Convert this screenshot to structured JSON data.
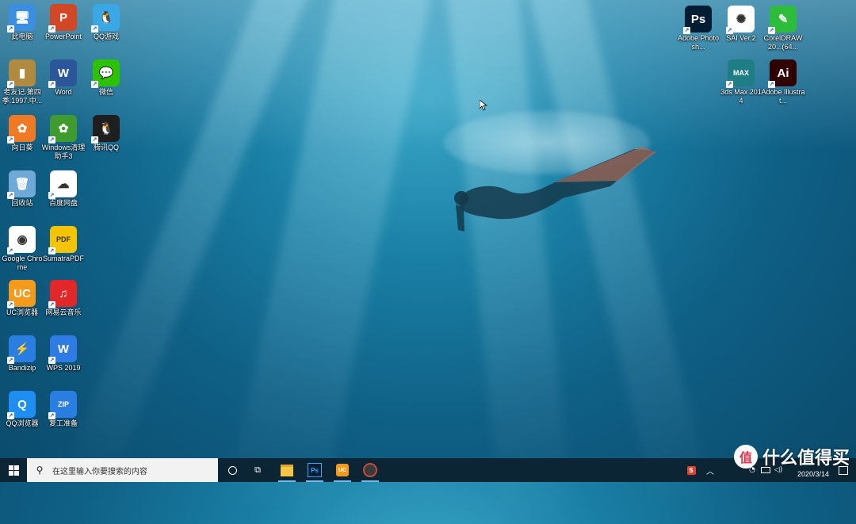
{
  "desktop": {
    "icons": [
      {
        "id": "computer",
        "label": "此电脑",
        "color": "#3b8ee0",
        "glyph": "🖥"
      },
      {
        "id": "powerpoint",
        "label": "PowerPoint",
        "color": "#d24726",
        "glyph": "P"
      },
      {
        "id": "qqgame",
        "label": "QQ游戏",
        "color": "#3aa7e6",
        "glyph": "🐧"
      },
      {
        "id": "laoyouji",
        "label": "老友记.第四季.1997.中...",
        "color": "#b08a3e",
        "glyph": "▮"
      },
      {
        "id": "word",
        "label": "Word",
        "color": "#2b579a",
        "glyph": "W"
      },
      {
        "id": "wechat",
        "label": "微信",
        "color": "#2dc100",
        "glyph": "💬"
      },
      {
        "id": "xiangrikui",
        "label": "向日葵",
        "color": "#f07a24",
        "glyph": "✿"
      },
      {
        "id": "windows-cleaner",
        "label": "Windows清理助手3",
        "color": "#3f9b2e",
        "glyph": "✿"
      },
      {
        "id": "tencent-qq",
        "label": "腾讯QQ",
        "color": "#1f1f1f",
        "glyph": "🐧"
      },
      {
        "id": "recycle-bin",
        "label": "回收站",
        "color": "#6fa9d8",
        "glyph": "🗑"
      },
      {
        "id": "baidu-netdisk",
        "label": "百度网盘",
        "color": "#ffffff",
        "glyph": "☁"
      },
      {
        "id": "chrome",
        "label": "Google Chrome",
        "color": "#ffffff",
        "glyph": "◉"
      },
      {
        "id": "sumatrapdf",
        "label": "SumatraPDF",
        "color": "#f5c400",
        "glyph": "PDF"
      },
      {
        "id": "uc-browser",
        "label": "UC浏览器",
        "color": "#f59a1b",
        "glyph": "UC"
      },
      {
        "id": "netease-music",
        "label": "网易云音乐",
        "color": "#e12727",
        "glyph": "♫"
      },
      {
        "id": "bandizip",
        "label": "Bandizip",
        "color": "#2a7de1",
        "glyph": "⚡"
      },
      {
        "id": "wps",
        "label": "WPS 2019",
        "color": "#2f7be6",
        "glyph": "W"
      },
      {
        "id": "qq-browser",
        "label": "QQ浏览器",
        "color": "#1e8ef2",
        "glyph": "Q"
      },
      {
        "id": "fugong",
        "label": "复工准备",
        "color": "#2a7de1",
        "glyph": "ZIP"
      },
      {
        "id": "photoshop",
        "label": "Adobe Photosh...",
        "color": "#001d34",
        "glyph": "Ps"
      },
      {
        "id": "sai",
        "label": "SAI Ver.2",
        "color": "#ffffff",
        "glyph": "✺"
      },
      {
        "id": "coreldraw",
        "label": "CorelDRAW 20...(64...",
        "color": "#2dbd3a",
        "glyph": "✎"
      },
      {
        "id": "3dsmax",
        "label": "3ds Max 2014",
        "color": "#1f7d85",
        "glyph": "MAX"
      },
      {
        "id": "illustrator",
        "label": "Adobe Illustrat...",
        "color": "#310000",
        "glyph": "Ai"
      }
    ]
  },
  "taskbar": {
    "search_placeholder": "在这里输入你要搜索的内容",
    "apps": [
      {
        "id": "file-explorer",
        "glyph": "📁"
      },
      {
        "id": "photoshop",
        "glyph": "Ps"
      },
      {
        "id": "uc",
        "glyph": "UC"
      },
      {
        "id": "recorder",
        "glyph": "●"
      }
    ],
    "tray": {
      "date": "2020/3/14"
    }
  },
  "watermark": {
    "text": "什么值得买",
    "logo": "值"
  }
}
